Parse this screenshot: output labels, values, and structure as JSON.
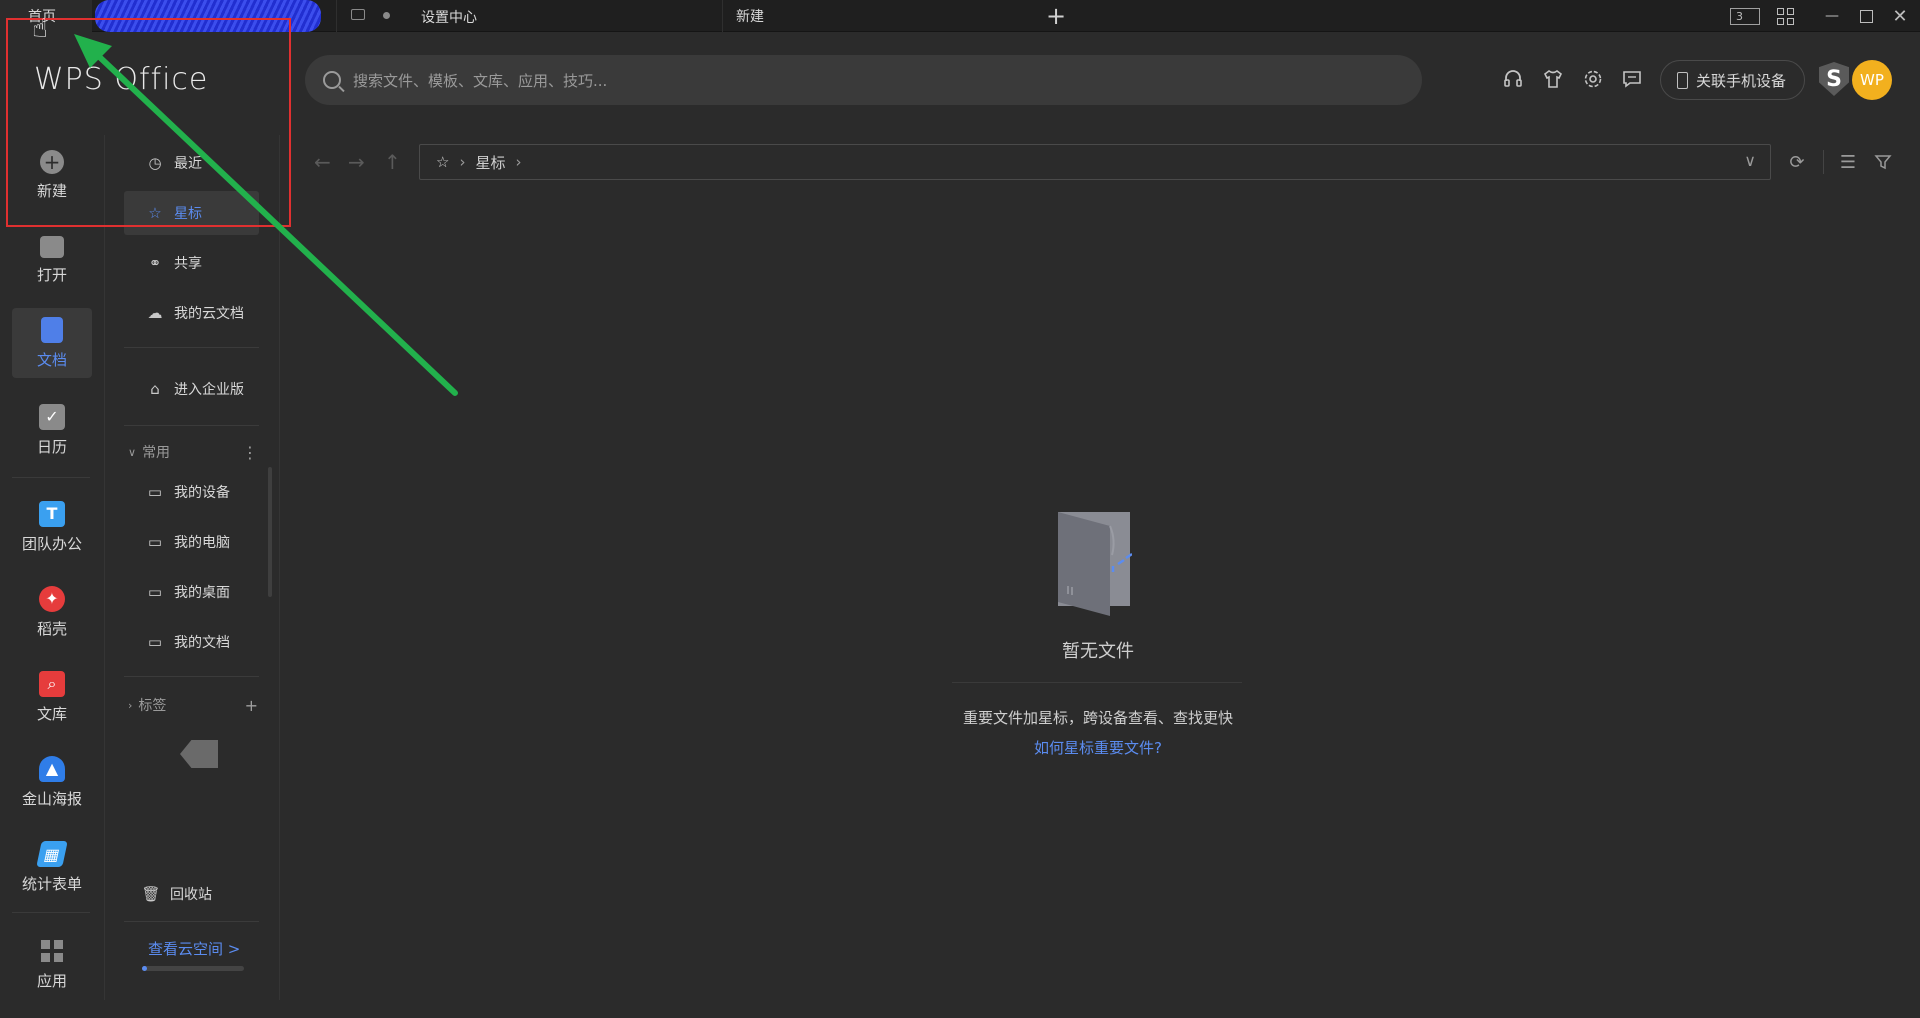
{
  "titlebar": {
    "tabs": [
      "首页",
      "设置中心",
      "新建"
    ],
    "tab_count": "3"
  },
  "header": {
    "logo": "WPS Office",
    "search_placeholder": "搜索文件、模板、文库、应用、技巧...",
    "phone_button": "关联手机设备",
    "shield_letter": "S",
    "avatar": "WP"
  },
  "rail": [
    {
      "label": "新建",
      "icon": "plus-icon"
    },
    {
      "label": "打开",
      "icon": "folder-icon"
    },
    {
      "label": "文档",
      "icon": "document-icon"
    },
    {
      "label": "日历",
      "icon": "calendar-icon"
    },
    {
      "label": "团队办公",
      "icon": "team-icon"
    },
    {
      "label": "稻壳",
      "icon": "docer-icon"
    },
    {
      "label": "文库",
      "icon": "library-icon"
    },
    {
      "label": "金山海报",
      "icon": "poster-icon"
    },
    {
      "label": "统计表单",
      "icon": "form-icon"
    },
    {
      "label": "应用",
      "icon": "apps-icon"
    }
  ],
  "subnav": {
    "items": [
      "最近",
      "星标",
      "共享",
      "我的云文档",
      "进入企业版"
    ],
    "group_common": "常用",
    "devices": [
      "我的设备",
      "我的电脑",
      "我的桌面",
      "我的文档"
    ],
    "group_tags": "标签",
    "recycle": "回收站",
    "cloud_link": "查看云空间 >",
    "cloud_usage": 0.05
  },
  "path": {
    "current": "星标"
  },
  "empty": {
    "title": "暂无文件",
    "desc": "重要文件加星标，跨设备查看、查找更快",
    "link": "如何星标重要文件?"
  },
  "colors": {
    "accent": "#5b8cf0",
    "background": "#2b2b2b",
    "annotation_red": "#e03030",
    "annotation_green": "#22b14c"
  }
}
